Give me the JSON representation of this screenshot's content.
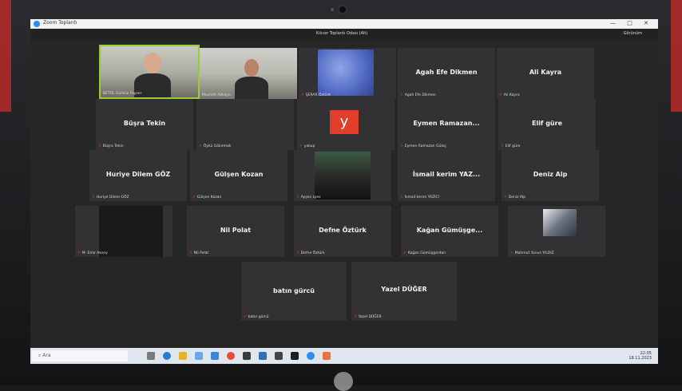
{
  "window": {
    "title": "Zoom Toplantı",
    "controls": "— □ ✕"
  },
  "meeting": {
    "title": "Kılıcer Toplantı Odası (Alt)",
    "view_toggle": "Görünüm"
  },
  "participants": [
    {
      "label": "BETÜL Gürbüz Feyzer",
      "kind": "video-a"
    },
    {
      "label": "Mustafa Akkaya",
      "kind": "video-b"
    },
    {
      "label": "ŞERAR Öztürk",
      "kind": "photo-sky"
    },
    {
      "name": "Agah Efe Dikmen",
      "label": "Agah Efe Dikmen"
    },
    {
      "name": "Ali Kayra",
      "label": "Ali Kayra"
    },
    {
      "name": "Büşra Tekin",
      "label": "Büşra Tekin"
    },
    {
      "name": "",
      "label": "Öykü Gökırmak"
    },
    {
      "label": "yakup",
      "kind": "y-logo",
      "logo_letter": "y"
    },
    {
      "name": "Eymen Ramazan...",
      "label": "Eymen Ramazan Güleç"
    },
    {
      "name": "Elif güre",
      "label": "Elif güre"
    },
    {
      "name": "Huriye Dilem GÖZ",
      "label": "Huriye Dilem GÖZ"
    },
    {
      "name": "Gülşen Kozan",
      "label": "Gülşen Kozan"
    },
    {
      "label": "Ayşen Lyes",
      "kind": "photo-people"
    },
    {
      "name": "İsmail kerim YAZ...",
      "label": "İsmail kerim YAZICI"
    },
    {
      "name": "Deniz Alp",
      "label": "Deniz Alp"
    },
    {
      "label": "M. Emir Aksoy",
      "kind": "black-video"
    },
    {
      "name": "Nil Polat",
      "label": "Nil Polat"
    },
    {
      "name": "Defne Öztürk",
      "label": "Defne Öztürk"
    },
    {
      "name": "Kağan Gümüşge...",
      "label": "Kağan Gümüşgerdan"
    },
    {
      "label": "Mahmut Yunus YILDIZ",
      "kind": "photo-pet"
    },
    {
      "name": "batın gürcü",
      "label": "batın gürcü"
    },
    {
      "name": "Yazel DÜĞER",
      "label": "Yazel DÜĞER"
    }
  ],
  "taskbar": {
    "search_placeholder": "Ara",
    "time": "22:05",
    "date": "18.11.2023"
  },
  "colors": {
    "active_speaker": "#9acd32",
    "muted_mic": "#ee2233",
    "tile_bg": "#323234"
  }
}
